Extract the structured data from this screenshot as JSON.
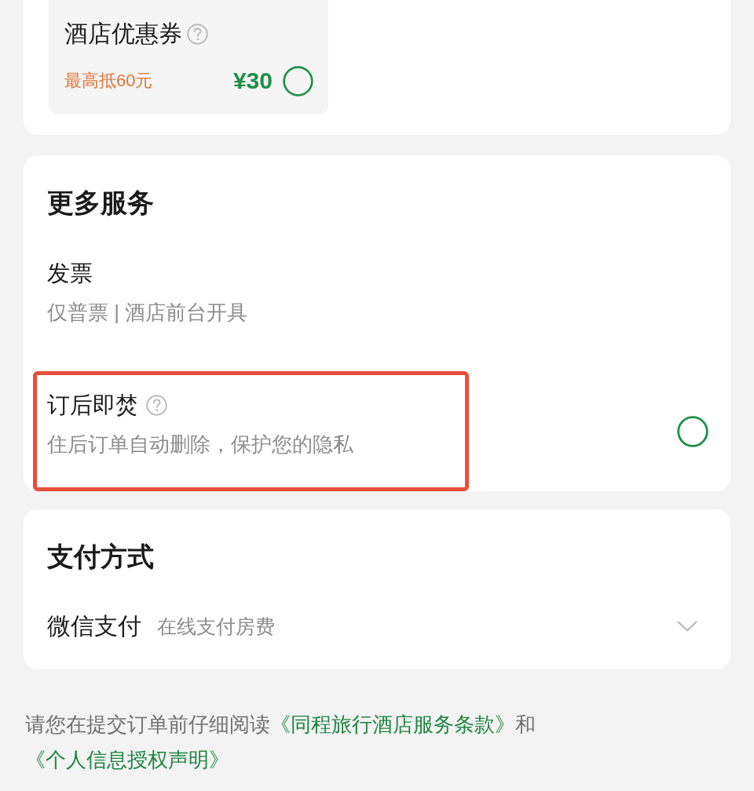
{
  "coupon_card": {
    "coupon": {
      "title": "酒店优惠券",
      "help": true,
      "note": "最高抵60元",
      "amount": "¥30",
      "checked": false
    }
  },
  "more_services": {
    "title": "更多服务",
    "items": [
      {
        "kind": "info",
        "title": "发票",
        "help": false,
        "subtitle": "仅普票 | 酒店前台开具",
        "highlighted": false
      },
      {
        "kind": "toggle",
        "title": "订后即焚",
        "help": true,
        "subtitle": "住后订单自动删除，保护您的隐私",
        "checked": false,
        "highlighted": true
      }
    ]
  },
  "payment": {
    "title": "支付方式",
    "method": "微信支付",
    "description": "在线支付房费"
  },
  "agreement": {
    "parts": [
      {
        "kind": "text",
        "text": "请您在提交订单前仔细阅读"
      },
      {
        "kind": "link",
        "text": "《同程旅行酒店服务条款》"
      },
      {
        "kind": "text",
        "text": "和"
      },
      {
        "kind": "link",
        "text": "《个人信息授权声明》"
      }
    ]
  }
}
